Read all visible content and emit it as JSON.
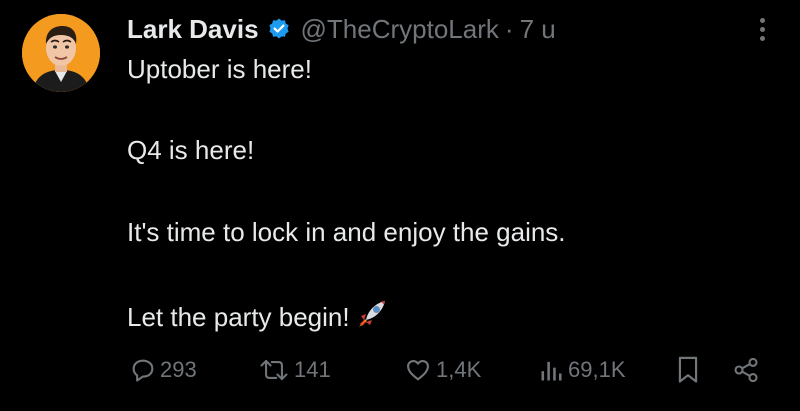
{
  "author": {
    "name": "Lark Davis",
    "handle": "@TheCryptoLark",
    "separator": "·",
    "time": "7 u",
    "avatar_bg": "#f39a1f",
    "verified_color": "#1d9bf0"
  },
  "post": {
    "lines": [
      "Uptober is here!",
      "Q4 is here!",
      "It's time to lock in and enjoy the gains.",
      "Let the party begin!"
    ],
    "emoji": "rocket-emoji"
  },
  "actions": {
    "replies": "293",
    "reposts": "141",
    "likes": "1,4K",
    "views": "69,1K"
  },
  "colors": {
    "background": "#000000",
    "text": "#e7e9ea",
    "muted": "#71767b"
  }
}
